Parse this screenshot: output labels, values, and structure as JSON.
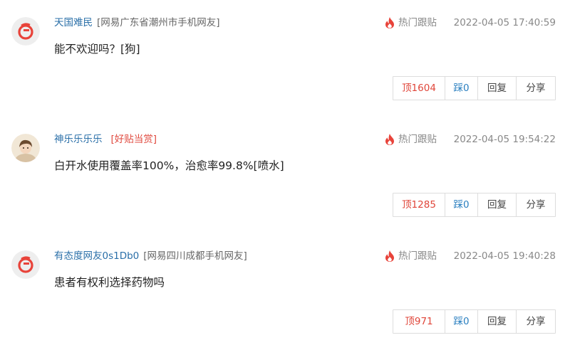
{
  "hot_icon": "fire-icon",
  "colors": {
    "username": "#2a6fa8",
    "badge": "#e04a3f",
    "up_count": "#e0463a",
    "down_count": "#2a7fc0",
    "avatar_logo": "#e8433a"
  },
  "comments": [
    {
      "avatar": "netease-logo-avatar",
      "username": "天国难民",
      "location": "[网易广东省潮州市手机网友]",
      "badge": "",
      "hot_label": "热门跟贴",
      "time": "2022-04-05 17:40:59",
      "content": "能不欢迎吗？[狗]",
      "up_label": "顶1604",
      "down_label": "踩0",
      "reply_label": "回复",
      "share_label": "分享"
    },
    {
      "avatar": "user-photo-avatar",
      "username": "神乐乐乐乐",
      "location": "",
      "badge": "[好贴当赏]",
      "hot_label": "热门跟贴",
      "time": "2022-04-05 19:54:22",
      "content": "白开水使用覆盖率100%，治愈率99.8%[喷水]",
      "up_label": "顶1285",
      "down_label": "踩0",
      "reply_label": "回复",
      "share_label": "分享"
    },
    {
      "avatar": "netease-logo-avatar",
      "username": "有态度网友0s1Db0",
      "location": "[网易四川成都手机网友]",
      "badge": "",
      "hot_label": "热门跟贴",
      "time": "2022-04-05 19:40:28",
      "content": "患者有权利选择药物吗",
      "up_label": "顶971",
      "down_label": "踩0",
      "reply_label": "回复",
      "share_label": "分享"
    }
  ]
}
